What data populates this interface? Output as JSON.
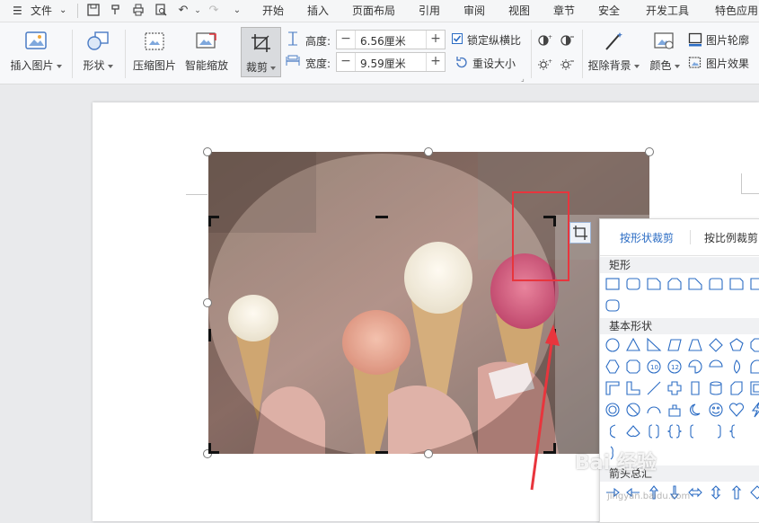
{
  "menu": {
    "file_label": "文件",
    "tabs": [
      "开始",
      "插入",
      "页面布局",
      "引用",
      "审阅",
      "视图",
      "章节",
      "安全",
      "开发工具",
      "特色应用"
    ]
  },
  "ribbon": {
    "insert_picture": "插入图片",
    "shape": "形状",
    "compress_picture": "压缩图片",
    "smart_scale": "智能缩放",
    "crop": "裁剪",
    "height_label": "高度:",
    "height_value": "6.56厘米",
    "width_label": "宽度:",
    "width_value": "9.59厘米",
    "lock_ratio": "锁定纵横比",
    "reset_size": "重设大小",
    "remove_bg": "抠除背景",
    "color": "颜色",
    "picture_outline": "图片轮廓",
    "picture_effect": "图片效果"
  },
  "crop_panel": {
    "tab_by_shape": "按形状裁剪",
    "tab_by_ratio": "按比例裁剪",
    "section_rect": "矩形",
    "section_basic": "基本形状",
    "section_arrow": "箭头总汇"
  },
  "watermark": {
    "text": "Bai 经验",
    "url": "jingyan.baidu.com"
  },
  "colors": {
    "accent": "#2b6cc4",
    "highlight": "#e8353d"
  }
}
